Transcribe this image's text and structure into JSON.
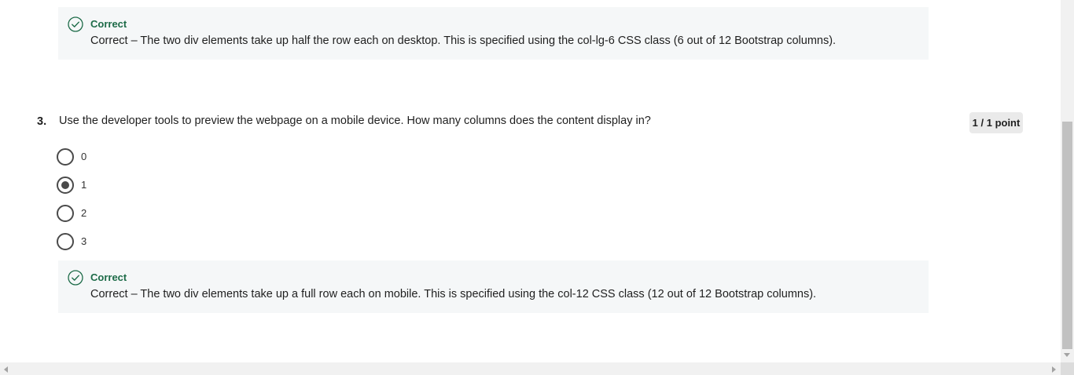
{
  "feedback_top": {
    "status": "Correct",
    "text": "Correct – The two div elements take up half the row each on desktop. This is specified using the col-lg-6 CSS class (6 out of 12 Bootstrap columns).",
    "icon": "check-circle-icon"
  },
  "question": {
    "number": "3.",
    "text": "Use the developer tools to preview the webpage on a mobile device. How many columns does the content display in?",
    "points": "1 / 1 point",
    "options": [
      "0",
      "1",
      "2",
      "3"
    ],
    "selected_option": "1"
  },
  "feedback_bottom": {
    "status": "Correct",
    "text": "Correct – The two div elements take up a full row each on mobile. This is specified using the col-12 CSS class (12 out of 12 Bootstrap columns).",
    "icon": "check-circle-icon"
  },
  "colors": {
    "correct_green": "#1d6b48",
    "feedback_bg": "#f5f7f8",
    "badge_bg": "#eaeaea"
  }
}
